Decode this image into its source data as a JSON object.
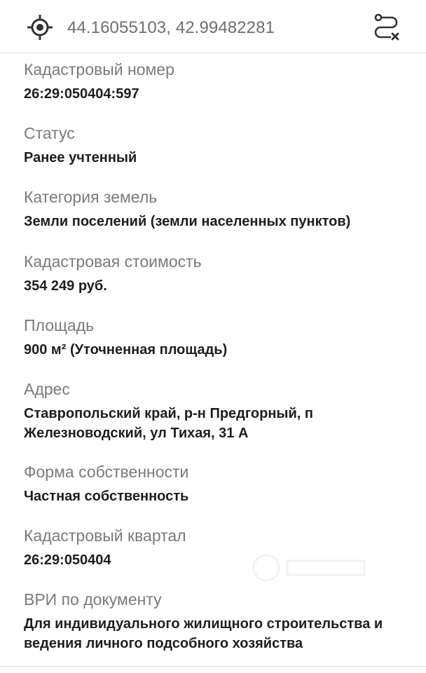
{
  "header": {
    "coordinates": "44.16055103, 42.99482281",
    "locate_icon": "crosshair-icon",
    "clear_route_icon": "route-clear-icon"
  },
  "fields": [
    {
      "label": "Кадастровый номер",
      "value": "26:29:050404:597"
    },
    {
      "label": "Статус",
      "value": "Ранее учтенный"
    },
    {
      "label": "Категория земель",
      "value": "Земли поселений (земли населенных пунктов)"
    },
    {
      "label": "Кадастровая стоимость",
      "value": "354 249 руб."
    },
    {
      "label": "Площадь",
      "value": "900 м² (Уточненная площадь)"
    },
    {
      "label": "Адрес",
      "value": "Ставропольский край, р-н Предгорный, п Железноводский, ул Тихая, 31 А"
    },
    {
      "label": "Форма собственности",
      "value": "Частная собственность"
    },
    {
      "label": "Кадастровый квартал",
      "value": "26:29:050404"
    },
    {
      "label": "ВРИ по документу",
      "value": "Для индивидуального жилищного строительства и ведения личного подсобного хозяйства"
    }
  ],
  "colors": {
    "label": "#7a7a7a",
    "value": "#1e1e1e",
    "icon": "#333333",
    "divider": "#e2e2e2"
  }
}
